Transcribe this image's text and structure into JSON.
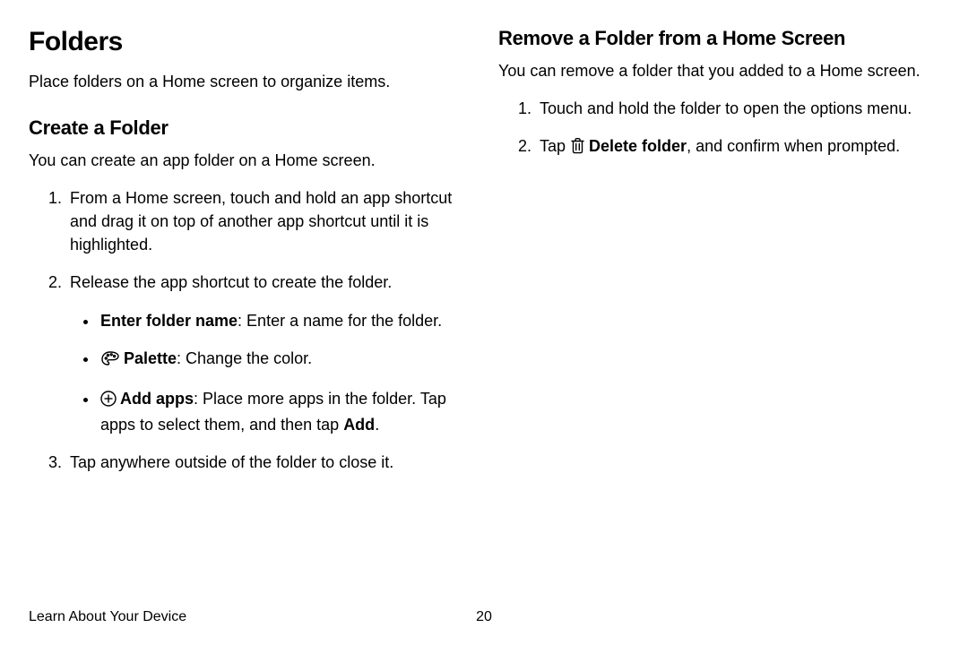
{
  "left": {
    "h1": "Folders",
    "intro": "Place folders on a Home screen to organize items.",
    "h2": "Create a Folder",
    "desc": "You can create an app folder on a Home screen.",
    "steps": {
      "s1": "From a Home screen, touch and hold an app shortcut and drag it on top of another app shortcut until it is highlighted.",
      "s2": "Release the app shortcut to create the folder.",
      "s3": "Tap anywhere outside of the folder to close it."
    },
    "bullets": {
      "b1_label": "Enter folder name",
      "b1_rest": ": Enter a name for the folder.",
      "b2_label": "Palette",
      "b2_rest": ": Change the color.",
      "b3_label": "Add apps",
      "b3_text": ": Place more apps in the folder. Tap apps to select them, and then tap ",
      "b3_add": "Add",
      "b3_end": "."
    }
  },
  "right": {
    "h2": "Remove a Folder from a Home Screen",
    "desc": "You can remove a folder that you added to a Home screen.",
    "steps": {
      "s1": "Touch and hold the folder to open the options menu.",
      "s2_pre": "Tap ",
      "s2_label": "Delete folder",
      "s2_post": ", and confirm when prompted."
    }
  },
  "footer": {
    "title": "Learn About Your Device",
    "page": "20"
  }
}
